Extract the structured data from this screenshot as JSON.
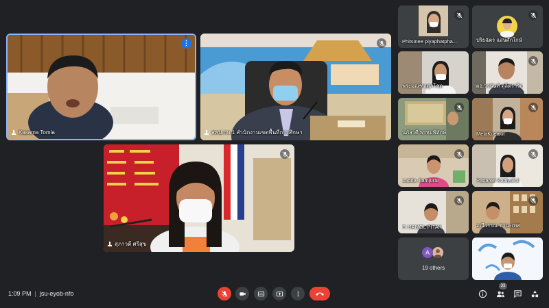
{
  "meeting": {
    "time": "1:09 PM",
    "code": "jsu-eyob-nfo"
  },
  "main_tiles": [
    {
      "name": "Kasama Tomla"
    },
    {
      "name": "สพป.กท.1 สำนักงานเขตพื้นที่การศึกษา"
    },
    {
      "name": "สุภาวดี ศรีสุข"
    }
  ],
  "side_tiles": [
    {
      "name": "Phitsinee piyaphatpha..."
    },
    {
      "name": "ปริยฉัตร แสนศักโกษ์"
    },
    {
      "name": "พระมณฑลศุภโชค"
    },
    {
      "name": "ผอ.วรนันท์ ดุลิตราวิส"
    },
    {
      "name": "นภัสวดี พรหมพิทักษ์"
    },
    {
      "name": "MelaKueakit"
    },
    {
      "name": "Ladda Jiamjurai"
    },
    {
      "name": "Pattaree Kattiyakul"
    },
    {
      "name": "P. HAMOL PITAK"
    },
    {
      "name": "มณีวรรณ ชานะเทศ"
    }
  ],
  "others": {
    "label": "19 others",
    "initial": "A"
  },
  "participants_count": "33",
  "colors": {
    "accent": "#8ab4f8",
    "danger": "#ea4335",
    "panel": "#3c4043",
    "bg": "#202124"
  },
  "icons": {
    "mic": "mic-off-icon",
    "camera": "camera-icon",
    "captions": "captions-icon",
    "present": "present-icon",
    "more": "more-vert-icon",
    "end": "call-end-icon",
    "info": "info-icon",
    "people": "people-icon",
    "chat": "chat-icon",
    "activities": "activities-icon"
  }
}
